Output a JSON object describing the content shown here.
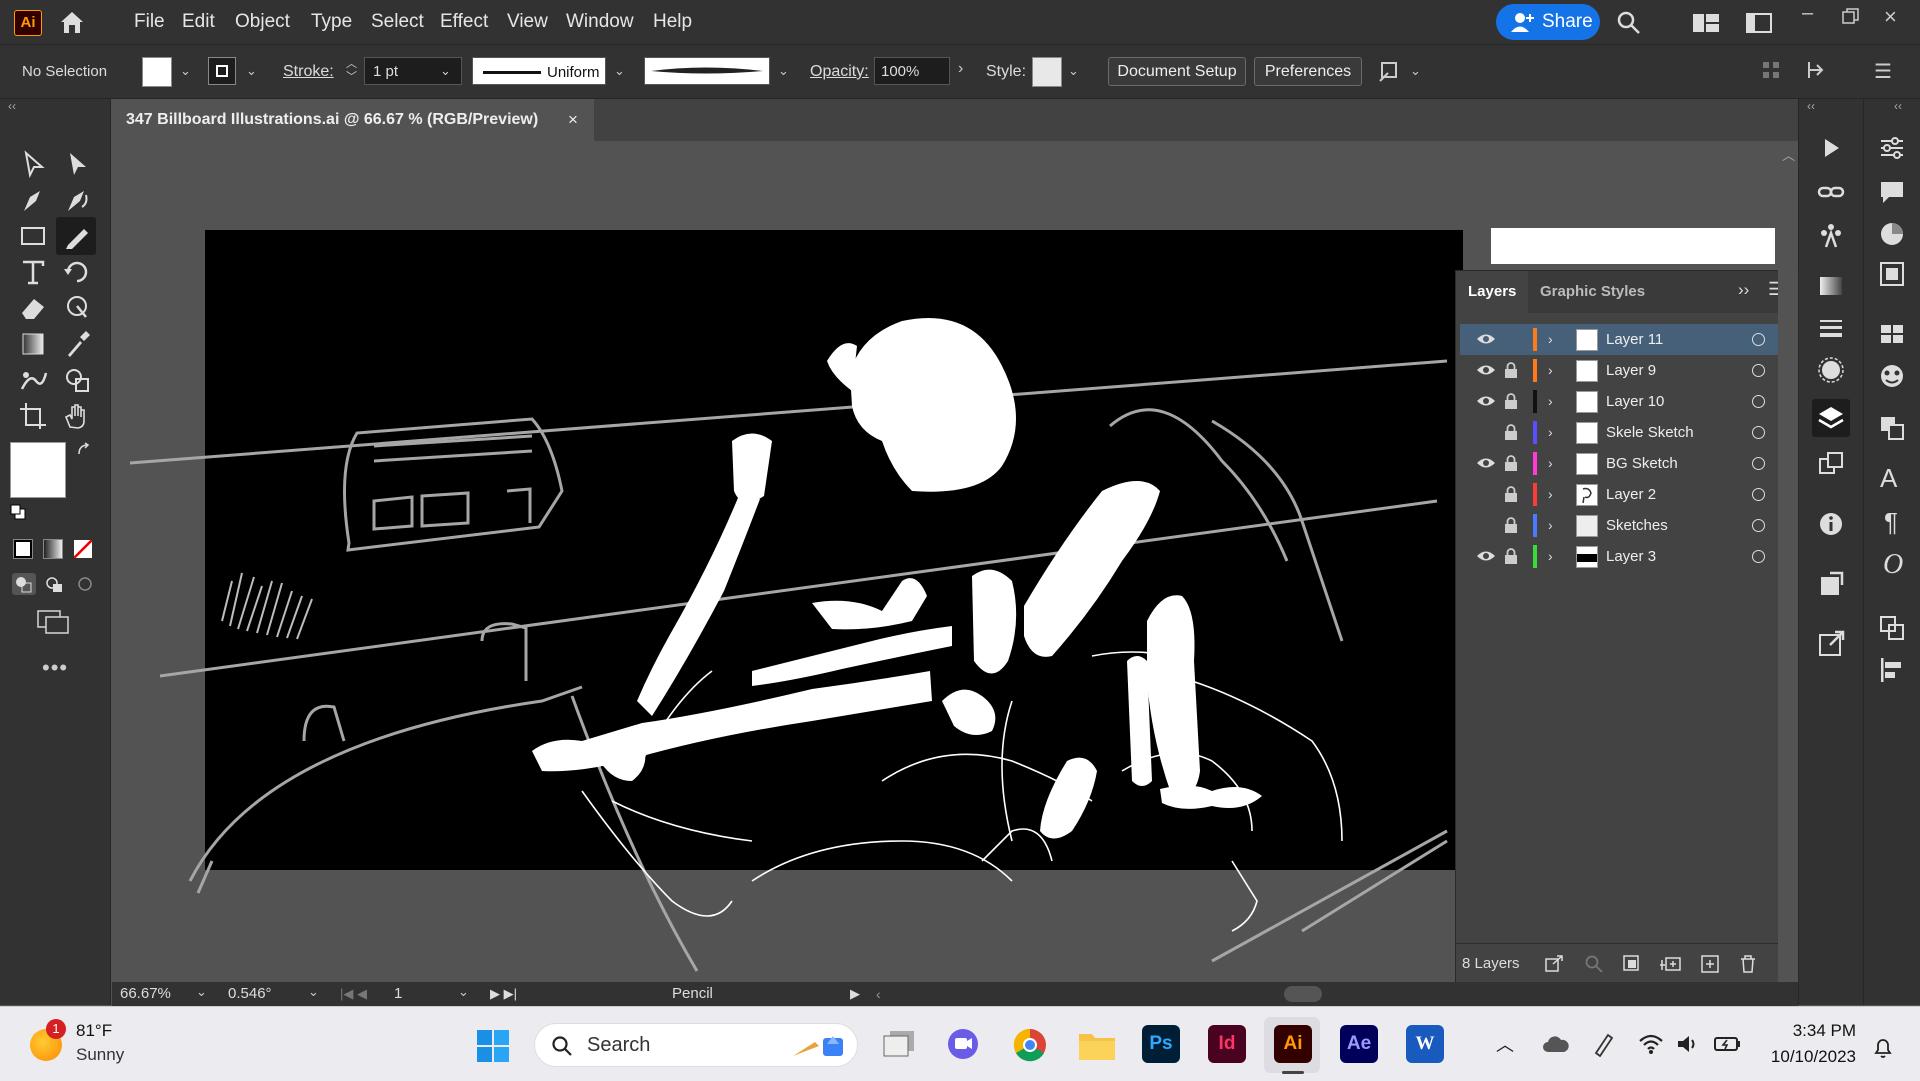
{
  "app": {
    "logo": "Ai"
  },
  "menu": [
    "File",
    "Edit",
    "Object",
    "Type",
    "Select",
    "Effect",
    "View",
    "Window",
    "Help"
  ],
  "share_label": "Share",
  "control": {
    "selection": "No Selection",
    "stroke_label": "Stroke:",
    "stroke_value": "1 pt",
    "profile": "Uniform",
    "opacity_label": "Opacity:",
    "opacity_value": "100%",
    "style_label": "Style:",
    "document_setup": "Document Setup",
    "preferences": "Preferences"
  },
  "document": {
    "tab_title": "347 Billboard Illustrations.ai @ 66.67 % (RGB/Preview)",
    "close": "×"
  },
  "layers_panel": {
    "tabs": [
      "Layers",
      "Graphic Styles"
    ],
    "layers": [
      {
        "name": "Layer 11",
        "color": "#ff7a1a",
        "visible": true,
        "locked": false,
        "selected": true
      },
      {
        "name": "Layer 9",
        "color": "#ff7a1a",
        "visible": true,
        "locked": true,
        "selected": false
      },
      {
        "name": "Layer 10",
        "color": "#111111",
        "visible": true,
        "locked": true,
        "selected": false
      },
      {
        "name": "Skele Sketch",
        "color": "#5a4fff",
        "visible": false,
        "locked": true,
        "selected": false
      },
      {
        "name": "BG Sketch",
        "color": "#ff3ad6",
        "visible": true,
        "locked": true,
        "selected": false
      },
      {
        "name": "Layer 2",
        "color": "#ff3a3a",
        "visible": false,
        "locked": true,
        "selected": false
      },
      {
        "name": "Sketches",
        "color": "#4a7aff",
        "visible": false,
        "locked": true,
        "selected": false
      },
      {
        "name": "Layer 3",
        "color": "#3adc3a",
        "visible": true,
        "locked": true,
        "selected": false
      }
    ],
    "count": "8 Layers"
  },
  "status": {
    "zoom": "66.67%",
    "rotation": "0.546°",
    "artboard": "1",
    "tool": "Pencil"
  },
  "taskbar": {
    "weather_badge": "1",
    "temp": "81°F",
    "condition": "Sunny",
    "search_placeholder": "Search",
    "apps": [
      {
        "name": "Ps",
        "bg": "#001e36",
        "fg": "#31a8ff"
      },
      {
        "name": "Id",
        "bg": "#49021f",
        "fg": "#ff3366"
      },
      {
        "name": "Ai",
        "bg": "#330000",
        "fg": "#ff9a00"
      },
      {
        "name": "Ae",
        "bg": "#00005b",
        "fg": "#9999ff"
      }
    ],
    "word_letter": "W",
    "time": "3:34 PM",
    "date": "10/10/2023"
  }
}
